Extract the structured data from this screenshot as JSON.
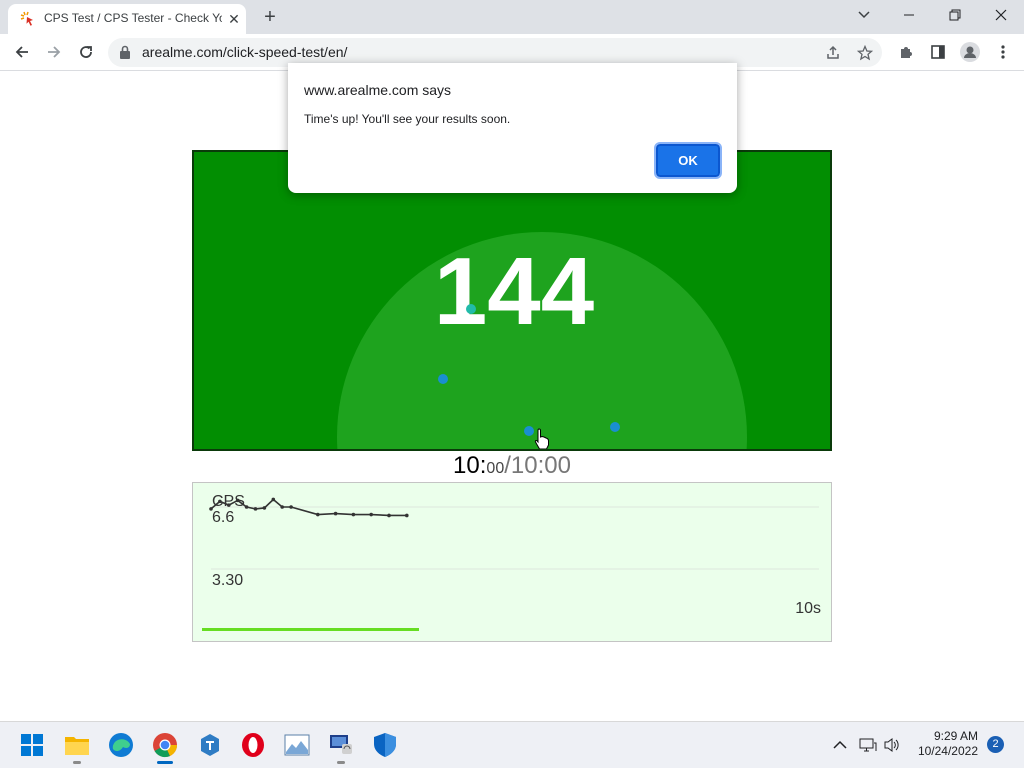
{
  "browser": {
    "tab_title": "CPS Test / CPS Tester - Check Yo",
    "url": "arealme.com/click-speed-test/en/"
  },
  "dialog": {
    "title": "www.arealme.com says",
    "message": "Time's up! You'll see your results soon.",
    "ok_label": "OK"
  },
  "game": {
    "score": "144",
    "timer_current": "10:",
    "timer_current_small": "00",
    "timer_total": "/10:00"
  },
  "cps_chart": {
    "label": "CPS",
    "top_value": "6.6",
    "mid_value": "3.30",
    "time_label": "10s",
    "progress": 0.35,
    "line_color": "#333333",
    "chart_data": {
      "type": "line",
      "ylabel": "CPS",
      "ylim": [
        0,
        6.6
      ],
      "points": [
        [
          0.0,
          6.5
        ],
        [
          0.25,
          6.9
        ],
        [
          0.5,
          6.7
        ],
        [
          0.75,
          6.95
        ],
        [
          1.0,
          6.6
        ],
        [
          1.25,
          6.5
        ],
        [
          1.5,
          6.55
        ],
        [
          1.75,
          7.0
        ],
        [
          2.0,
          6.6
        ],
        [
          2.25,
          6.6
        ],
        [
          3.0,
          6.2
        ],
        [
          3.5,
          6.25
        ],
        [
          4.0,
          6.2
        ],
        [
          4.5,
          6.2
        ],
        [
          5.0,
          6.15
        ],
        [
          5.5,
          6.15
        ]
      ]
    }
  },
  "colors": {
    "game_bg": "#028e02",
    "glow": "#1ea31e",
    "panel_bg": "#ebffeb",
    "accent": "#1a73e8"
  },
  "taskbar": {
    "time": "9:29 AM",
    "date": "10/24/2022",
    "notification_count": "2",
    "apps": [
      "start-icon",
      "file-explorer-icon",
      "edge-icon",
      "chrome-icon",
      "teams-icon",
      "opera-icon",
      "photos-icon",
      "remote-desktop-icon",
      "defender-icon"
    ]
  }
}
